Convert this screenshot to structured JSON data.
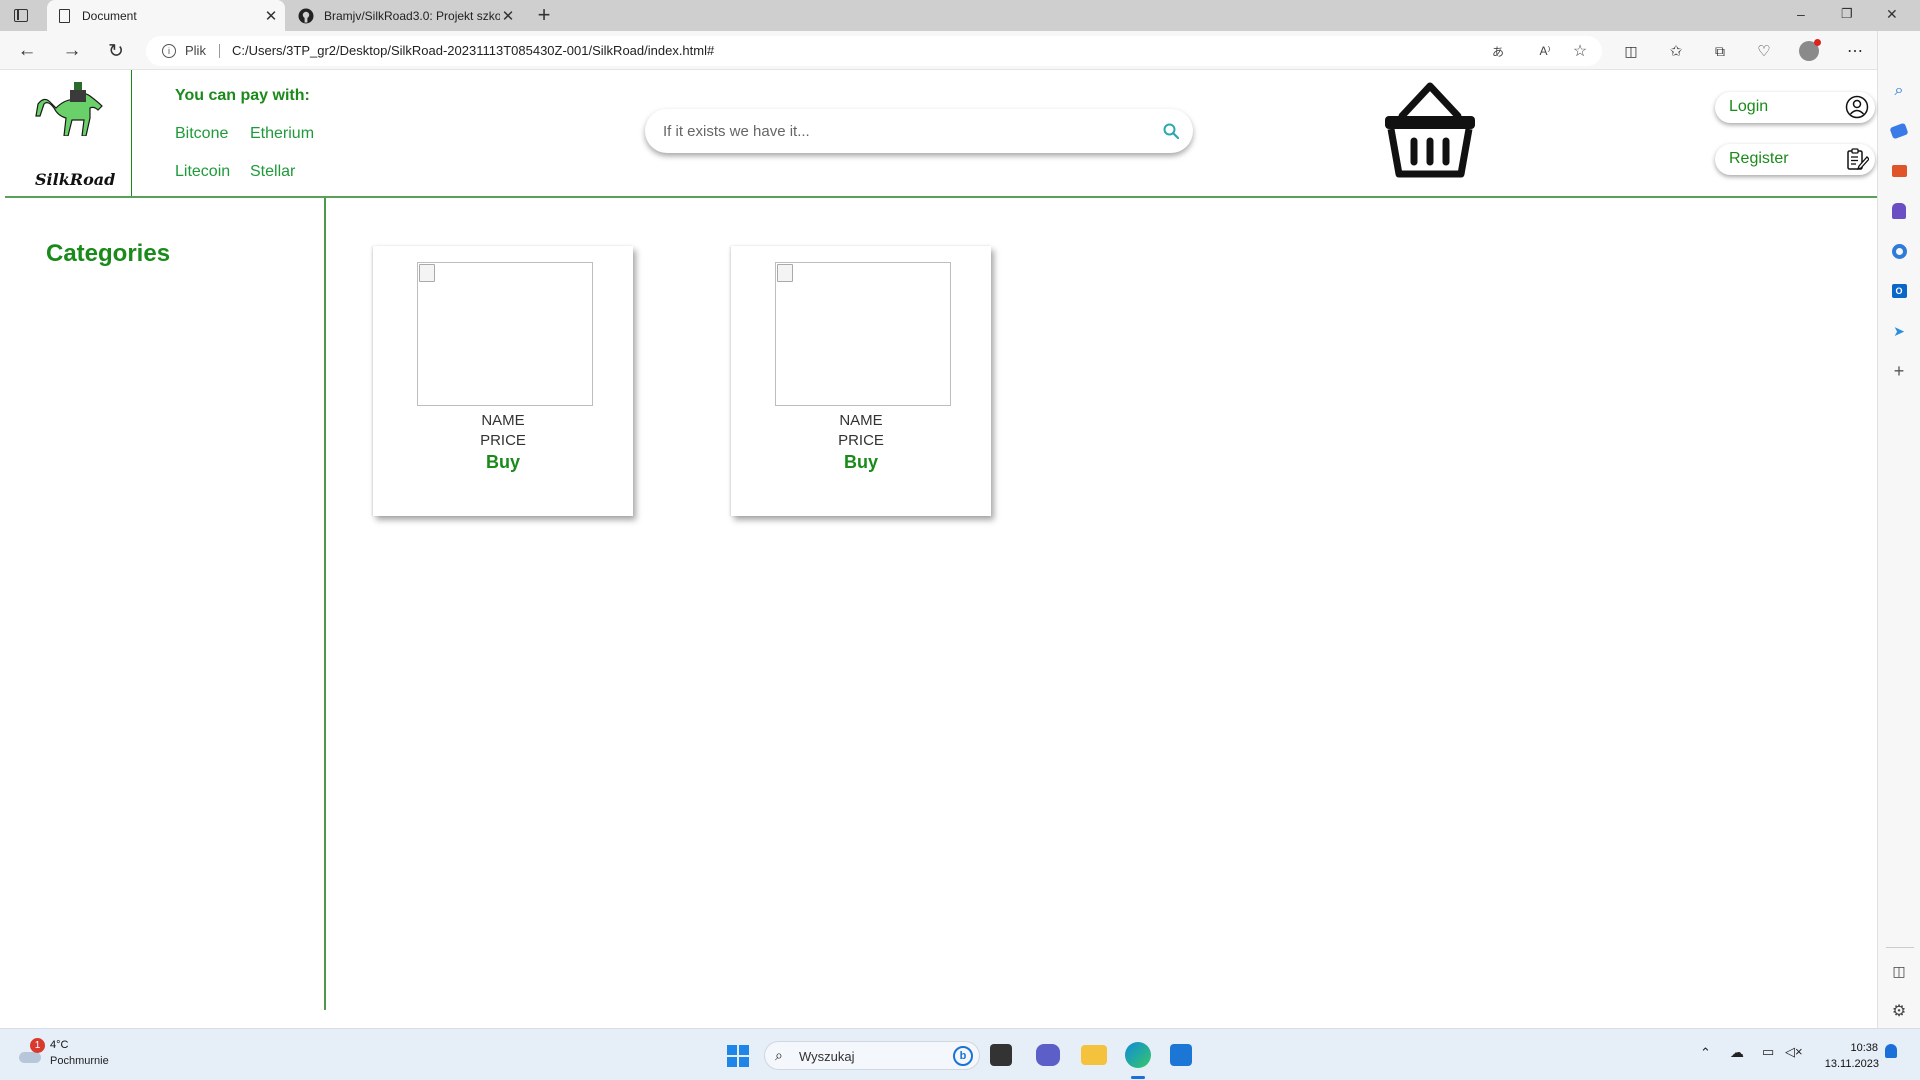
{
  "browser": {
    "tabs": [
      {
        "title": "Document",
        "active": true
      },
      {
        "title": "Bramjv/SilkRoad3.0: Projekt szkolny",
        "active": false
      }
    ],
    "address": {
      "prefix": "Plik",
      "url": "C:/Users/3TP_gr2/Desktop/SilkRoad-20231113T085430Z-001/SilkRoad/index.html#"
    },
    "icons": [
      "tab-actions-icon",
      "page-icon",
      "github-icon",
      "close-icon",
      "new-tab-icon",
      "back-icon",
      "forward-icon",
      "reload-icon",
      "info-icon",
      "translate-icon",
      "read-aloud-icon",
      "favorite-icon",
      "split-screen-icon",
      "favorites-icon",
      "collections-icon",
      "browser-essentials-icon",
      "profile-icon",
      "more-icon",
      "copilot-icon"
    ]
  },
  "window_controls": {
    "minimize": "–",
    "restore": "❐",
    "close": "✕"
  },
  "site": {
    "logo_text": "SilkRoad",
    "pay_heading": "You can pay with:",
    "pay_methods": [
      "Bitcone",
      "Etherium",
      "Litecoin",
      "Stellar"
    ],
    "search": {
      "placeholder": "If it exists we have it..."
    },
    "auth": {
      "login": "Login",
      "register": "Register"
    },
    "categories_title": "Categories",
    "products": [
      {
        "name": "NAME",
        "price": "PRICE",
        "action": "Buy"
      },
      {
        "name": "NAME",
        "price": "PRICE",
        "action": "Buy"
      }
    ],
    "colors": {
      "accent": "#158a15",
      "link": "#1f9a3a"
    }
  },
  "taskbar": {
    "weather": {
      "temp": "4°C",
      "condition": "Pochmurnie",
      "badge": "1"
    },
    "search_placeholder": "Wyszukaj",
    "time": "10:38",
    "date": "13.11.2023"
  }
}
